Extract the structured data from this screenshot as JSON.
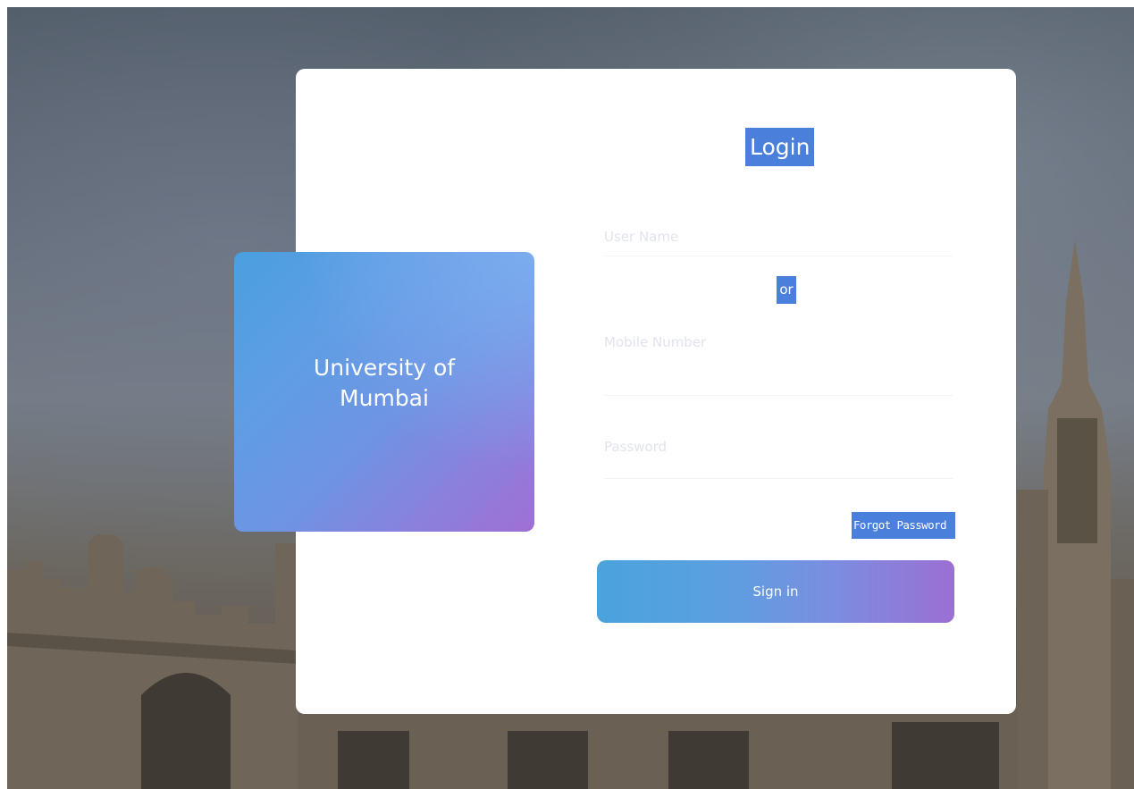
{
  "brand": {
    "title": "University of Mumbai"
  },
  "login": {
    "title": "Login",
    "username_placeholder": "User Name",
    "or_text": "or",
    "mobile_placeholder": "Mobile Number",
    "password_placeholder": "Password",
    "forgot_label": "Forgot Password",
    "signin_label": "Sign in"
  },
  "colors": {
    "accent": "#4a7fdc",
    "gradient_start": "#4aa3dc",
    "gradient_end": "#9b6fd3"
  }
}
